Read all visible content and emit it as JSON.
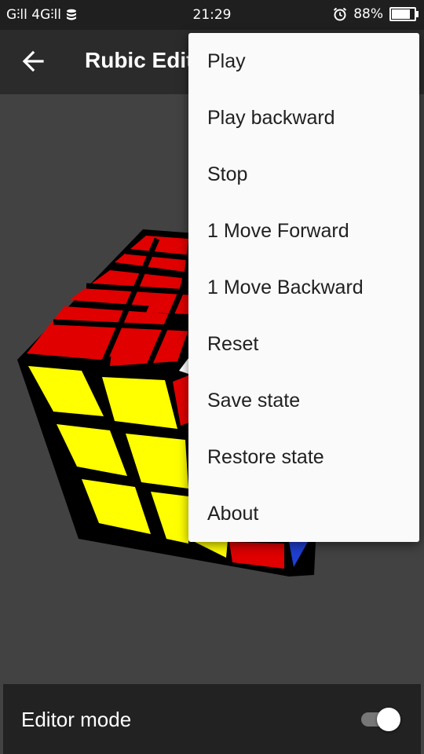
{
  "status_bar": {
    "signal_text": "G⫶ll 4G⫶ll",
    "time": "21:29",
    "battery": "88%",
    "battery_level": 0.88,
    "icons": [
      "signal-icon",
      "data-icon",
      "alarm-icon",
      "battery-icon"
    ]
  },
  "app_bar": {
    "title": "Rubic Edit",
    "back_icon": "arrow-left-icon"
  },
  "overflow_menu": {
    "items": [
      "Play",
      "Play backward",
      "Stop",
      "1 Move Forward",
      "1 Move Backward",
      "Reset",
      "Save state",
      "Restore state",
      "About"
    ]
  },
  "bottom_bar": {
    "label": "Editor mode",
    "switch_on": true
  },
  "colors": {
    "background": "#424242",
    "cube_red": "#e00000",
    "cube_yellow": "#ffff00",
    "cube_blue": "#1f3fd0",
    "cube_white": "#ffffff",
    "menu_bg": "#fafafa"
  }
}
